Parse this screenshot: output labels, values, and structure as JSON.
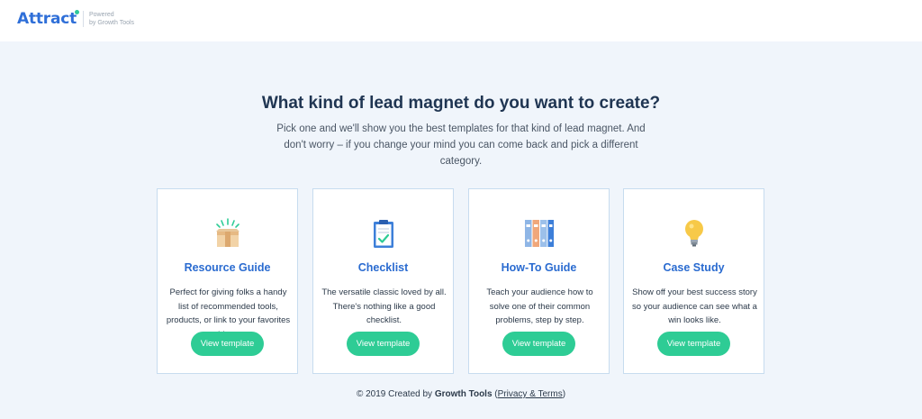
{
  "header": {
    "logo": "Attract",
    "powered_line1": "Powered",
    "powered_line2": "by Growth Tools"
  },
  "main": {
    "headline": "What kind of lead magnet do you want to create?",
    "subtitle": "Pick one and we'll show you the best templates for that kind of lead magnet. And don't worry – if you change your mind you can come back and pick a different category."
  },
  "cards": [
    {
      "icon": "box-icon",
      "title": "Resource Guide",
      "description": "Perfect for giving folks a handy list of recommended tools, products, or link to your favorites things.",
      "button": "View template"
    },
    {
      "icon": "clipboard-check-icon",
      "title": "Checklist",
      "description": "The versatile classic loved by all. There's nothing like a good checklist.",
      "button": "View template"
    },
    {
      "icon": "binders-icon",
      "title": "How-To Guide",
      "description": "Teach your audience how to solve one of their common problems, step by step.",
      "button": "View template"
    },
    {
      "icon": "lightbulb-icon",
      "title": "Case Study",
      "description": "Show off your best success story so your audience can see what a win looks like.",
      "button": "View template"
    }
  ],
  "footer": {
    "copyright": "© 2019 Created by ",
    "company": "Growth Tools",
    "paren_open": " (",
    "link": "Privacy & Terms",
    "paren_close": ")"
  },
  "colors": {
    "brand_blue": "#2f6fd8",
    "accent_green": "#2ecc95",
    "background": "#f0f5fb"
  }
}
